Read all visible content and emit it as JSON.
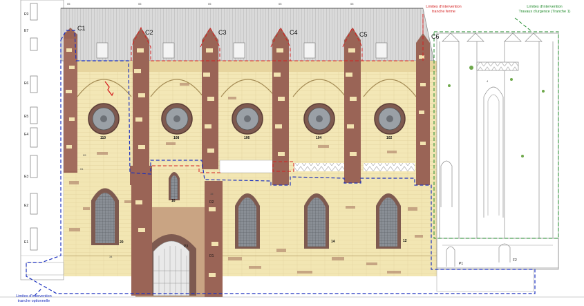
{
  "annotations": {
    "red_zone": {
      "line1": "Limites d'intervention",
      "line2": "tranche ferme"
    },
    "green_zone": {
      "line1": "Limites d'intervention",
      "line2": "Travaux d'urgence (Tranche 1)"
    },
    "blue_zone": {
      "line1": "Limites d'intervention",
      "line2": "tranche optionnelle"
    }
  },
  "buttress_labels": [
    "C1",
    "C2",
    "C3",
    "C4",
    "C5",
    "C6"
  ],
  "rose_window_labels": [
    "110",
    "108",
    "106",
    "104",
    "102"
  ],
  "lower_window_labels": [
    "20",
    "16",
    "14",
    "12"
  ],
  "storey_labels": [
    "E9",
    "E7",
    "E6",
    "E5",
    "E4",
    "E3",
    "E2",
    "E1"
  ],
  "door_labels": [
    "P3",
    "P1",
    "F2",
    "D1",
    "D2"
  ],
  "small_labels": [
    "05",
    "05",
    "05",
    "05",
    "05",
    "09",
    "34",
    "01",
    "15",
    "4"
  ],
  "colors": {
    "stone_light": "#f3e7b6",
    "stone_mid": "#e3cf93",
    "stone_dark": "#9a6456",
    "roof": "#cfcfcf",
    "zone_red": "#d42020",
    "zone_green": "#1f8a2a",
    "zone_blue": "#1a2fbf"
  }
}
